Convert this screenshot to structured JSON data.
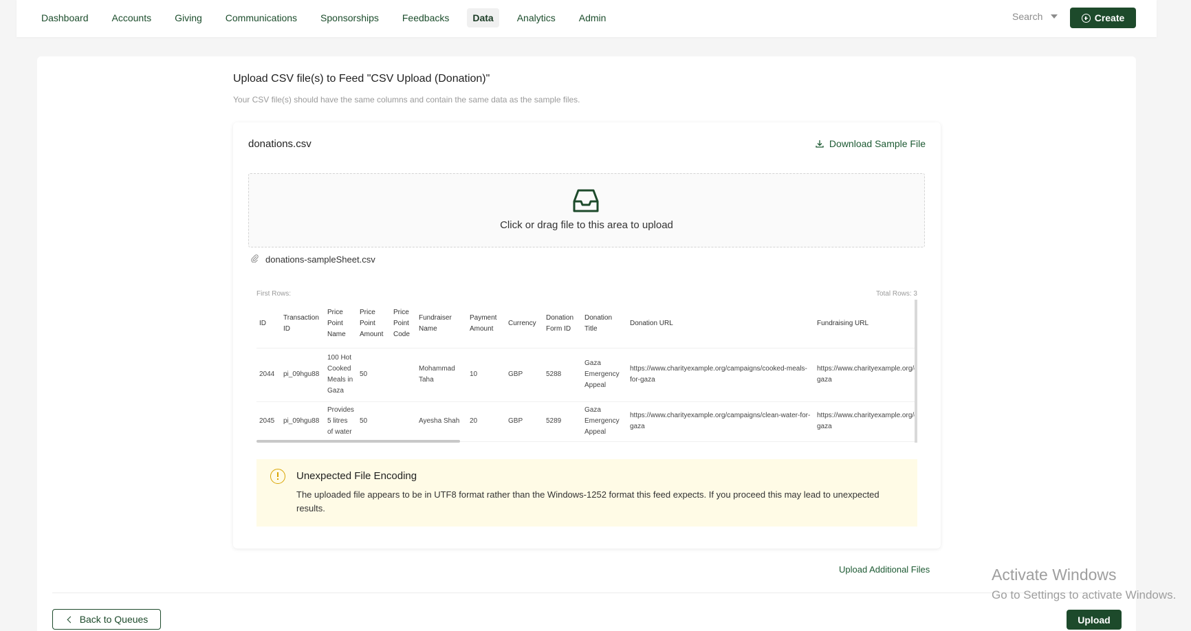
{
  "nav": {
    "items": [
      {
        "label": "Dashboard"
      },
      {
        "label": "Accounts"
      },
      {
        "label": "Giving"
      },
      {
        "label": "Communications"
      },
      {
        "label": "Sponsorships"
      },
      {
        "label": "Feedbacks"
      },
      {
        "label": "Data",
        "active": true
      },
      {
        "label": "Analytics"
      },
      {
        "label": "Admin"
      }
    ],
    "search_label": "Search",
    "create_label": "Create"
  },
  "page": {
    "title": "Upload CSV file(s) to Feed \"CSV Upload (Donation)\"",
    "subtitle": "Your CSV file(s) should have the same columns and contain the same data as the sample files."
  },
  "file_card": {
    "file_name": "donations.csv",
    "download_label": "Download Sample File",
    "dropzone_text": "Click or drag file to this area to upload",
    "attached_file": "donations-sampleSheet.csv",
    "first_rows_label": "First Rows:",
    "total_rows_label": "Total Rows: 3"
  },
  "table": {
    "headers": [
      "ID",
      "Transaction ID",
      "Price Point Name",
      "Price Point Amount",
      "Price Point Code",
      "Fundraiser Name",
      "Payment Amount",
      "Currency",
      "Donation Form ID",
      "Donation Title",
      "Donation URL",
      "Fundraising URL"
    ],
    "rows": [
      [
        "2044",
        "pi_09hgu88",
        "100 Hot Cooked Meals in Gaza",
        "50",
        "",
        "Mohammad Taha",
        "10",
        "GBP",
        "5288",
        "Gaza Emergency Appeal",
        "https://www.charityexample.org/campaigns/cooked-meals-for-gaza",
        "https://www.charityexample.org/campaigns/cooked-meals-for-gaza"
      ],
      [
        "2045",
        "pi_09hgu88",
        "Provides 5 litres of water",
        "50",
        "",
        "Ayesha Shah",
        "20",
        "GBP",
        "5289",
        "Gaza Emergency Appeal",
        "https://www.charityexample.org/campaigns/clean-water-for-gaza",
        "https://www.charityexample.org/campaigns/cooked-meals-for-gaza"
      ]
    ]
  },
  "warning": {
    "title": "Unexpected File Encoding",
    "text": "The uploaded file appears to be in UTF8 format rather than the Windows-1252 format this feed expects. If you proceed this may lead to unexpected results."
  },
  "footer": {
    "upload_additional": "Upload Additional Files",
    "back_label": "Back to Queues",
    "upload_label": "Upload"
  },
  "watermark": {
    "title": "Activate Windows",
    "subtitle": "Go to Settings to activate Windows."
  },
  "colors": {
    "brand": "#1d4a2b",
    "warning_bg": "#fffbe6",
    "warning_icon": "#d9a400"
  }
}
